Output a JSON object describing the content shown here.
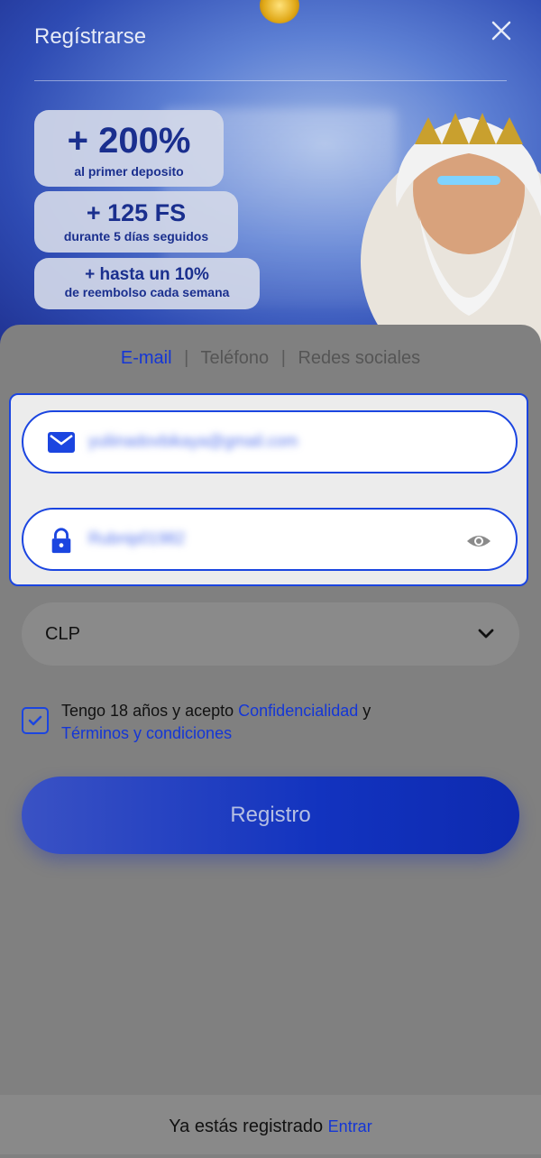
{
  "header": {
    "title": "Regístrarse",
    "close_icon": "close-icon"
  },
  "promos": [
    {
      "big": "+ 200%",
      "small": "al primer deposito"
    },
    {
      "big": "+ 125 FS",
      "small": "durante 5 días seguidos"
    },
    {
      "big": "+ hasta un 10%",
      "small": "de reembolso cada semana"
    }
  ],
  "tabs": {
    "email": "E-mail",
    "separator": "|",
    "phone": "Teléfono",
    "social": "Redes sociales",
    "active": "E-mail"
  },
  "form": {
    "email_value": "yuliinadovbikaya@gmail.com",
    "password_value": "Rubnip01982",
    "currency": "CLP"
  },
  "terms": {
    "prefix": "Tengo 18 años y acepto ",
    "privacy": "Confidencialidad",
    "and": " y",
    "terms_link": "Términos y condiciones",
    "checked": true
  },
  "register_label": "Registro",
  "footer": {
    "text": "Ya estás registrado ",
    "login": "Entrar"
  },
  "colors": {
    "accent": "#1b45e0",
    "link": "#1436d6"
  }
}
